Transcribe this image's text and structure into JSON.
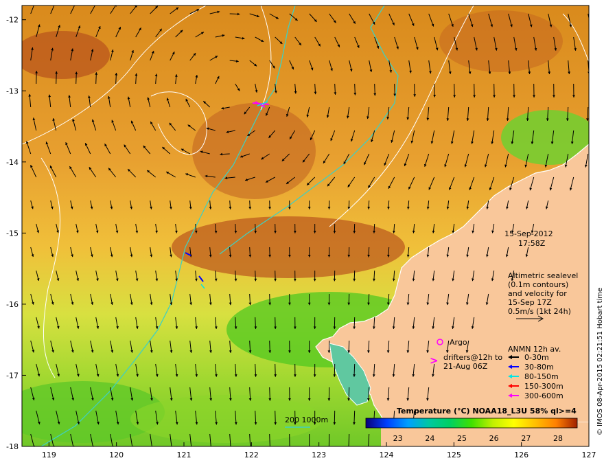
{
  "map": {
    "date_line": "15-Sep-2012",
    "time_line": "17:58Z",
    "altimetry_lines": [
      "Altimetric sealevel",
      "(0.1m contours)",
      "and velocity for",
      "15-Sep 17Z",
      "0.5m/s (1kt 24h)"
    ],
    "argo_label": "Argo",
    "drifter_symbol": ">",
    "drifter_lines": [
      "drifters@12h to",
      "21-Aug 06Z"
    ],
    "anmn_title": "ANMN 12h av.",
    "anmn_items": [
      {
        "label": "0-30m",
        "color": "#000000"
      },
      {
        "label": "30-80m",
        "color": "#0000ff"
      },
      {
        "label": "80-150m",
        "color": "#00e5e5"
      },
      {
        "label": "150-300m",
        "color": "#ff0000"
      },
      {
        "label": "300-600m",
        "color": "#ff00ff"
      }
    ],
    "depth_contours_label": "200  1000m",
    "colorbar": {
      "title": "Temperature (°C) NOAA18_L3U 58% ql>=4",
      "ticks": [
        "23",
        "24",
        "25",
        "26",
        "27",
        "28"
      ],
      "colors": [
        "#0a007a",
        "#0040ff",
        "#00a0ff",
        "#00c8a0",
        "#00d060",
        "#40e000",
        "#c0f000",
        "#ffff00",
        "#ffc000",
        "#ff8000",
        "#e05000",
        "#a02000"
      ]
    },
    "credit": "© IMOS 08-Apr-2015 02:21:51 Hobart time",
    "x_ticks": [
      "119",
      "120",
      "121",
      "122",
      "123",
      "124",
      "125",
      "126",
      "127"
    ],
    "y_ticks": [
      "-12",
      "-13",
      "-14",
      "-15",
      "-16",
      "-17",
      "-18"
    ],
    "colors": {
      "land": "#f9c79a",
      "coast": "#ffffff",
      "isobath": "#40d0c0",
      "sealevel_contour": "#ffffff",
      "warm_sst": "#d98a1c",
      "hot_sst": "#b9561c",
      "mid_sst": "#f0d040",
      "cool_sst": "#8cd52a",
      "argo": "#ff00ff",
      "drifter": "#ff00ff"
    }
  }
}
